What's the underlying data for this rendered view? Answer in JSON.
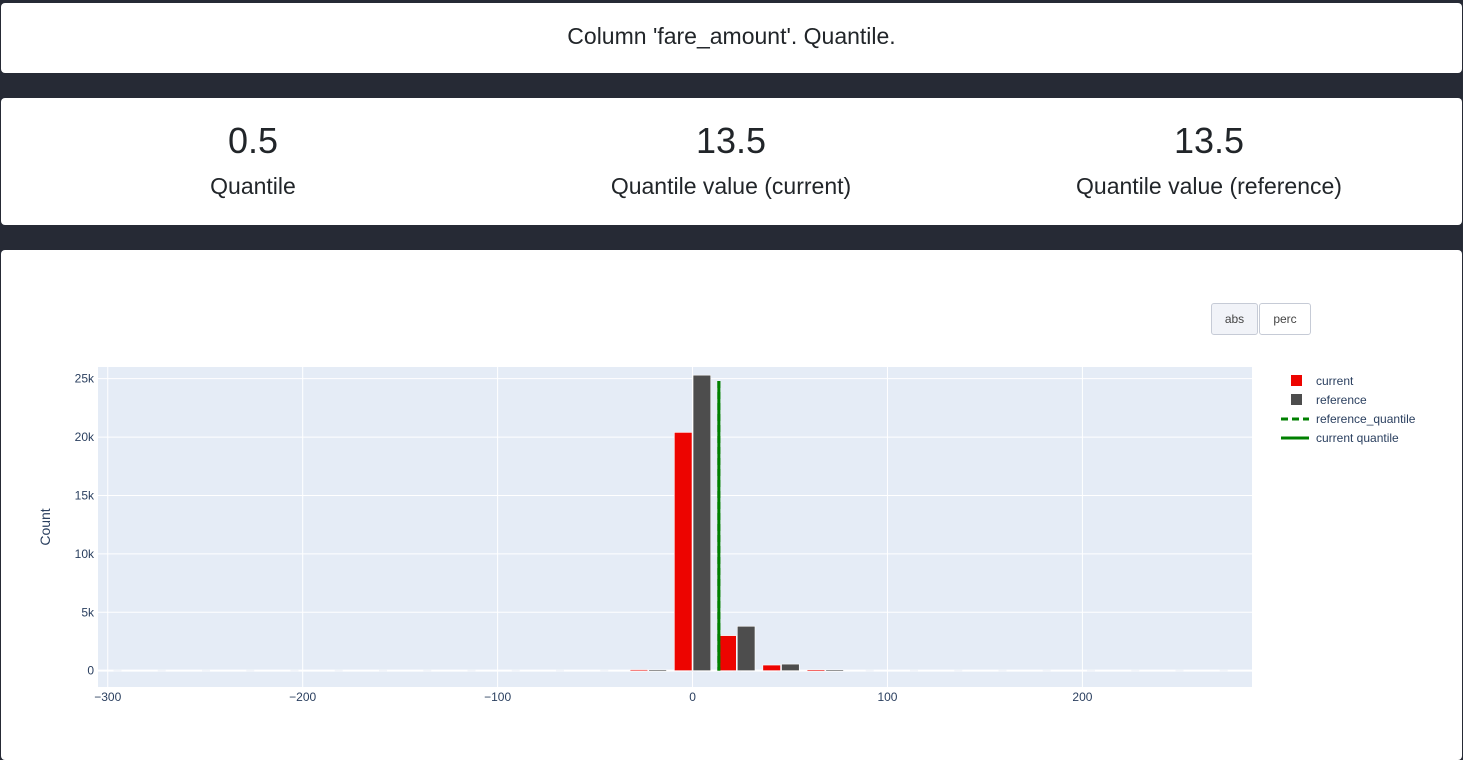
{
  "header": {
    "title": "Column 'fare_amount'. Quantile."
  },
  "metrics": [
    {
      "value": "0.5",
      "label": "Quantile"
    },
    {
      "value": "13.5",
      "label": "Quantile value (current)"
    },
    {
      "value": "13.5",
      "label": "Quantile value (reference)"
    }
  ],
  "controls": {
    "abs_label": "abs",
    "perc_label": "perc",
    "active": "abs"
  },
  "colors": {
    "current": "#ed0400",
    "reference": "#4d4d4d",
    "quantile_line": "#008000",
    "plot_bg": "#e5ecf6"
  },
  "chart_data": {
    "type": "bar",
    "ylabel": "Count",
    "xlabel": "",
    "xlim": [
      -305,
      287
    ],
    "ylim": [
      -1400,
      26000
    ],
    "x_ticks": [
      -300,
      -200,
      -100,
      0,
      100,
      200
    ],
    "x_tick_labels": [
      "−300",
      "−200",
      "−100",
      "0",
      "100",
      "200"
    ],
    "y_ticks": [
      0,
      5000,
      10000,
      15000,
      20000,
      25000
    ],
    "y_tick_labels": [
      "0",
      "5k",
      "10k",
      "15k",
      "20k",
      "25k"
    ],
    "bin_width": 22.7,
    "bin_centers": [
      -22.7,
      0,
      22.7,
      45.4,
      68.1
    ],
    "series": [
      {
        "name": "current",
        "values": [
          90,
          20400,
          3000,
          480,
          70
        ]
      },
      {
        "name": "reference",
        "values": [
          60,
          25300,
          3800,
          560,
          50
        ]
      }
    ],
    "quantile_lines": [
      {
        "name": "reference_quantile",
        "x": 13.5,
        "style": "dash"
      },
      {
        "name": "current quantile",
        "x": 13.5,
        "style": "solid"
      }
    ],
    "legend": [
      "current",
      "reference",
      "reference_quantile",
      "current quantile"
    ]
  }
}
